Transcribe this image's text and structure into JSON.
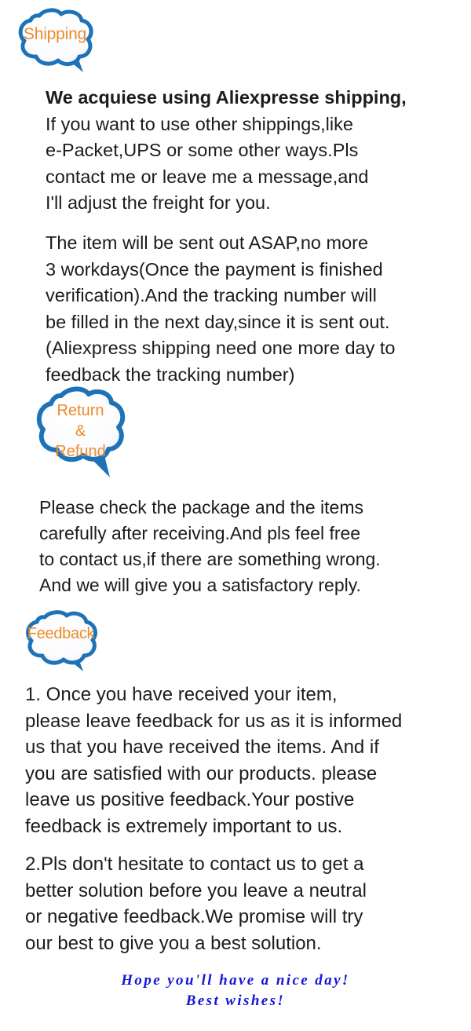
{
  "background_color": "#ffffff",
  "accent_colors": {
    "bubble_outline_blue": "#1E73B8",
    "bubble_text_orange": "#ED8B2B",
    "body_text": "#1c1c1c",
    "closing_blue": "#1515D8"
  },
  "sections": {
    "shipping": {
      "bubble_label": "Shipping",
      "paragraph_1_bold": "We acquiese using Aliexpresse shipping,",
      "paragraph_1_rest": "If you want to use other shippings,like\ne-Packet,UPS or some other ways.Pls\ncontact me or leave me a message,and\nI'll adjust the freight for you.",
      "paragraph_2": "The item will be sent out ASAP,no more\n3 workdays(Once the payment is finished\nverification).And the tracking number will\nbe filled in the next day,since it is sent out.\n(Aliexpress shipping need one more day to\nfeedback the tracking number)"
    },
    "return_refund": {
      "bubble_label": "Return\n&\nRefund",
      "paragraph": "Please check the package and the items\ncarefully after receiving.And pls feel free\nto contact us,if there are something wrong.\nAnd we will give you a satisfactory reply."
    },
    "feedback": {
      "bubble_label": "Feedback",
      "paragraph_1": "1. Once you have received your item,\nplease leave feedback for us as it is informed\nus that you have received the items. And if\nyou are satisfied with our products. please\nleave us positive feedback.Your postive\nfeedback is extremely important to us.",
      "paragraph_2": "2.Pls don't hesitate to contact us to get a\nbetter solution before you leave a neutral\nor negative feedback.We promise will try\nour best to give you a best solution."
    }
  },
  "closing": {
    "line_1": "Hope you'll have a nice day!",
    "line_2": "Best wishes!"
  }
}
